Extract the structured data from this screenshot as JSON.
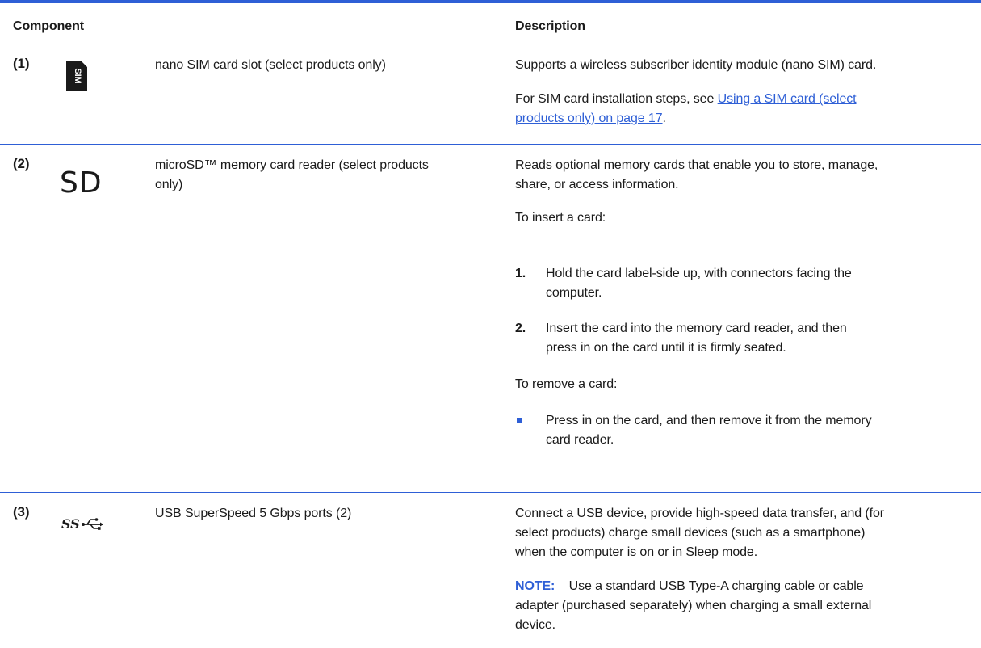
{
  "header": {
    "component": "Component",
    "description": "Description"
  },
  "rows": [
    {
      "num": "(1)",
      "icon": "sim-card-icon",
      "icon_text": "SIM",
      "name": "nano SIM card slot (select products only)",
      "desc_p1": "Supports a wireless subscriber identity module (nano SIM) card.",
      "desc_p2_prefix": "For SIM card installation steps, see ",
      "desc_p2_link_line1": "Using a SIM card (select",
      "desc_p2_link_line2": "products only) on page 17",
      "desc_p2_suffix": "."
    },
    {
      "num": "(2)",
      "icon": "sd-card-icon",
      "icon_text": "SD",
      "name_line1": "microSD™ memory card reader (select products",
      "name_line2": "only)",
      "desc_line1": "Reads optional memory cards that enable you to store, manage,",
      "desc_line2": "share, or access information.",
      "insert_heading": "To insert a card:",
      "steps": [
        {
          "num": "1.",
          "line1": "Hold the card label-side up, with connectors facing the",
          "line2": "computer."
        },
        {
          "num": "2.",
          "line1": "Insert the card into the memory card reader, and then",
          "line2": "press in on the card until it is firmly seated."
        }
      ],
      "remove_heading": "To remove a card:",
      "bullet_line1": "Press in on the card, and then remove it from the memory",
      "bullet_line2": "card reader."
    },
    {
      "num": "(3)",
      "icon": "usb-superspeed-icon",
      "icon_text": "SS",
      "name": "USB SuperSpeed 5 Gbps ports (2)",
      "desc_line1": "Connect a USB device, provide high-speed data transfer, and (for",
      "desc_line2": "select products) charge small devices (such as a smartphone)",
      "desc_line3": "when the computer is on or in Sleep mode.",
      "note_label": "NOTE:",
      "note_line1": "Use a standard USB Type-A charging cable or cable",
      "note_line2": "adapter (purchased separately) when charging a small external",
      "note_line3": "device."
    }
  ],
  "colors": {
    "accent": "#2e5fd6",
    "text": "#1a1a1a"
  }
}
